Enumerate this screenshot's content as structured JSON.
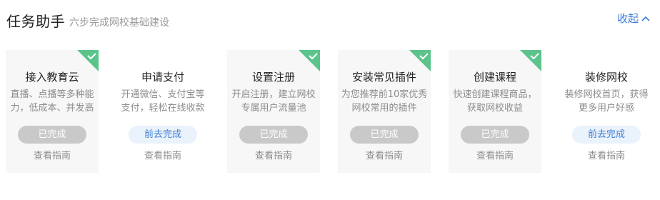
{
  "header": {
    "title": "任务助手",
    "subtitle": "六步完成网校基础建设",
    "collapse_label": "收起"
  },
  "colors": {
    "accent": "#3a7bd5",
    "done_badge": "#5cc48b",
    "done_button": "#c9c9c9",
    "todo_button_bg": "#eaf2fb"
  },
  "cards": [
    {
      "title": "接入教育云",
      "desc": "直播、点播等多种能力，低成本、并发高",
      "status": "已完成",
      "done": true,
      "guide": "查看指南"
    },
    {
      "title": "申请支付",
      "desc": "开通微信、支付宝等支付，轻松在线收款",
      "status": "前去完成",
      "done": false,
      "guide": "查看指南"
    },
    {
      "title": "设置注册",
      "desc": "开启注册，建立网校专属用户流量池",
      "status": "已完成",
      "done": true,
      "guide": "查看指南"
    },
    {
      "title": "安装常见插件",
      "desc": "为您推荐前10家优秀网校常用的插件",
      "status": "已完成",
      "done": true,
      "guide": "查看指南"
    },
    {
      "title": "创建课程",
      "desc": "快速创建课程商品，获取网校收益",
      "status": "已完成",
      "done": true,
      "guide": "查看指南"
    },
    {
      "title": "装修网校",
      "desc": "装修网校首页，获得更多用户好感",
      "status": "前去完成",
      "done": false,
      "guide": "查看指南"
    }
  ]
}
